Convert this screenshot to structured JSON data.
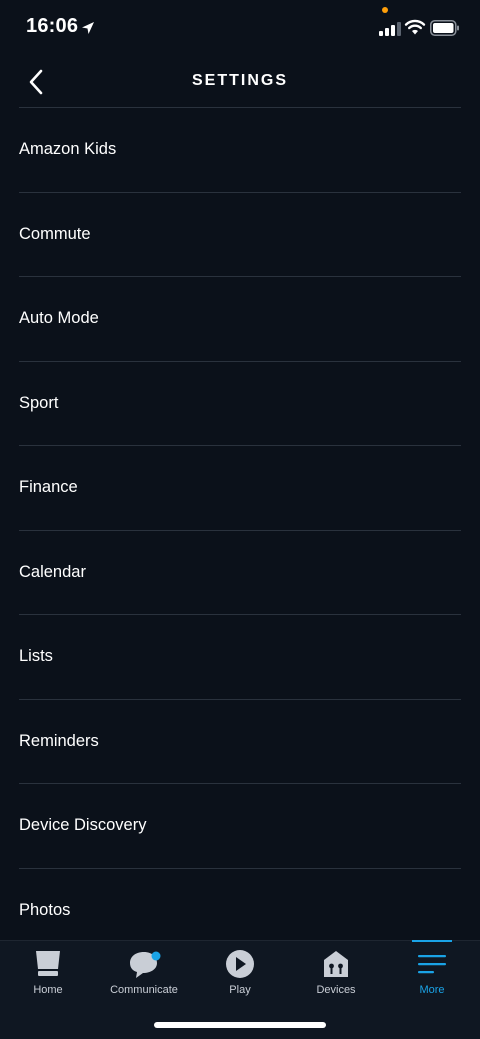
{
  "status_bar": {
    "time": "16:06",
    "colors": {
      "recording_dot": "#ff9f0a"
    }
  },
  "header": {
    "title": "SETTINGS",
    "back_icon": "chevron-left-icon"
  },
  "settings": {
    "items": [
      {
        "label": "Amazon Kids"
      },
      {
        "label": "Commute"
      },
      {
        "label": "Auto Mode"
      },
      {
        "label": "Sport"
      },
      {
        "label": "Finance"
      },
      {
        "label": "Calendar"
      },
      {
        "label": "Lists"
      },
      {
        "label": "Reminders"
      },
      {
        "label": "Device Discovery"
      },
      {
        "label": "Photos"
      }
    ]
  },
  "tabs": [
    {
      "label": "Home",
      "icon": "home-icon",
      "active": false
    },
    {
      "label": "Communicate",
      "icon": "chat-bubble-icon",
      "active": false
    },
    {
      "label": "Play",
      "icon": "play-icon",
      "active": false
    },
    {
      "label": "Devices",
      "icon": "devices-house-icon",
      "active": false
    },
    {
      "label": "More",
      "icon": "menu-icon",
      "active": true
    }
  ],
  "colors": {
    "background": "#0b111a",
    "divider": "#2a323d",
    "accent": "#1aa3e6",
    "tab_bar": "#0f1722"
  }
}
